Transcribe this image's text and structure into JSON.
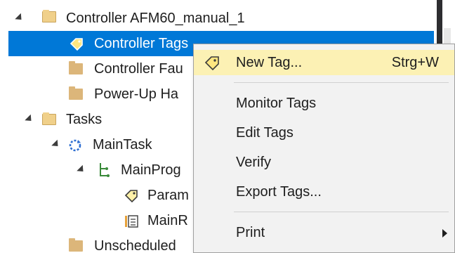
{
  "tree": {
    "items": [
      {
        "label": "Controller AFM60_manual_1"
      },
      {
        "label": "Controller Tags"
      },
      {
        "label": "Controller Fau"
      },
      {
        "label": "Power-Up Ha"
      },
      {
        "label": "Tasks"
      },
      {
        "label": "MainTask"
      },
      {
        "label": "MainProg"
      },
      {
        "label": "Param"
      },
      {
        "label": "MainR"
      },
      {
        "label": "Unscheduled"
      }
    ]
  },
  "context_menu": {
    "new_tag": {
      "label": "New Tag...",
      "shortcut": "Strg+W"
    },
    "monitor_tags": "Monitor Tags",
    "edit_tags": "Edit Tags",
    "verify": "Verify",
    "export_tags": "Export Tags...",
    "print": "Print"
  },
  "colors": {
    "selection": "#0078d7",
    "menu_hover": "#fcf1b4",
    "menu_bg": "#f2f2f2",
    "folder": "#dcb67a"
  }
}
